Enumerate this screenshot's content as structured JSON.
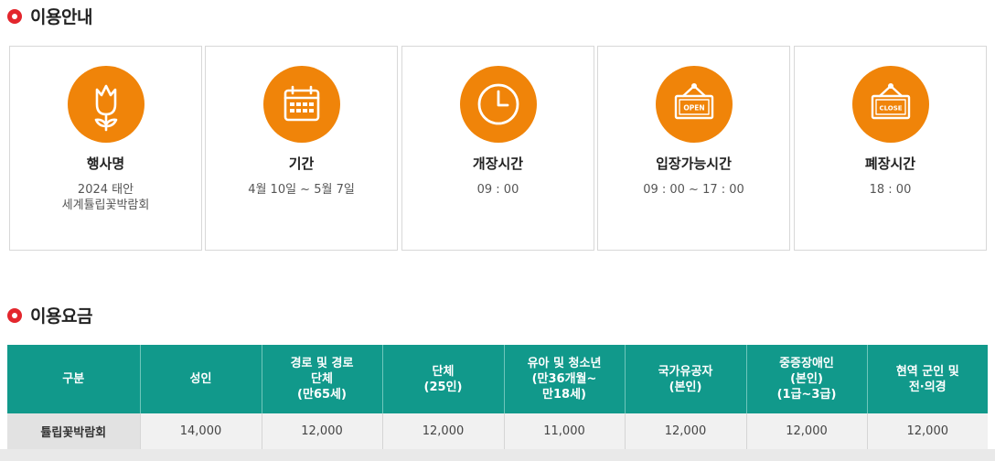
{
  "sections": {
    "info_title": "이용안내",
    "fee_title": "이용요금"
  },
  "cards": [
    {
      "name": "행사명",
      "value": "2024 태안\n세계튤립꽃박람회",
      "icon": "tulip-icon"
    },
    {
      "name": "기간",
      "value": "4월 10일 ~ 5월 7일",
      "icon": "calendar-icon"
    },
    {
      "name": "개장시간",
      "value": "09 : 00",
      "icon": "clock-icon"
    },
    {
      "name": "입장가능시간",
      "value": "09 : 00 ~ 17 : 00",
      "icon": "open-sign-icon"
    },
    {
      "name": "폐장시간",
      "value": "18 : 00",
      "icon": "close-sign-icon"
    }
  ],
  "signs": {
    "open": "OPEN",
    "close": "CLOSE"
  },
  "fee_table": {
    "headers": [
      "구분",
      "성인",
      "경로 및 경로\n단체\n(만65세)",
      "단체\n(25인)",
      "유아 및 청소년\n(만36개월~\n만18세)",
      "국가유공자\n(본인)",
      "중증장애인\n(본인)\n(1급~3급)",
      "현역 군인 및\n전·의경"
    ],
    "rows": [
      [
        "튤립꽃박람회",
        "14,000",
        "12,000",
        "12,000",
        "11,000",
        "12,000",
        "12,000",
        "12,000"
      ]
    ]
  },
  "colors": {
    "accent_orange": "#f08409",
    "table_header": "#11998b",
    "bullet_red": "#e3262d"
  }
}
